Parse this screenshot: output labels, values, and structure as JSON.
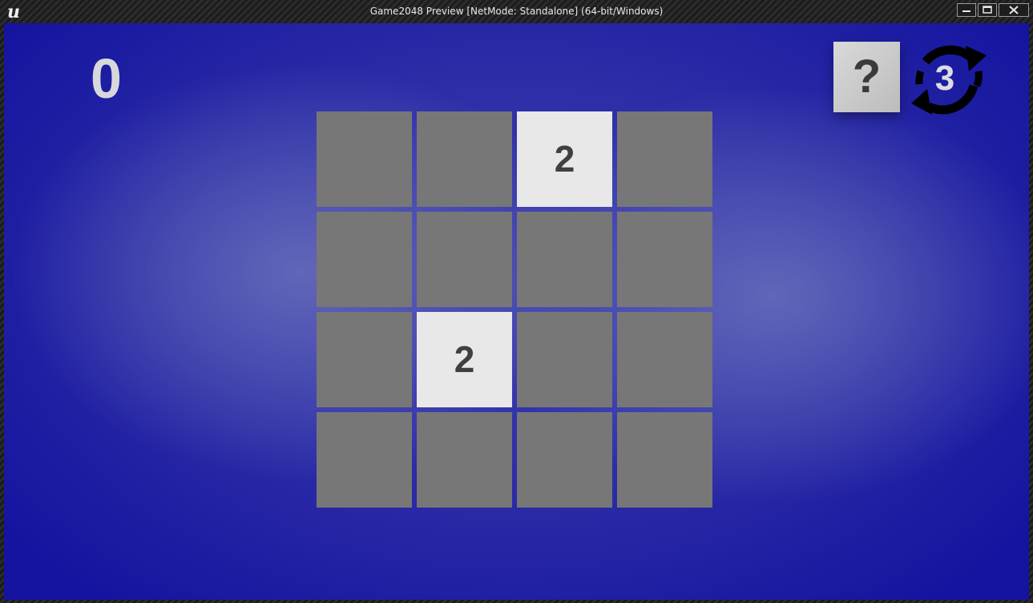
{
  "window": {
    "title": "Game2048 Preview [NetMode: Standalone] (64-bit/Windows)",
    "logo_icon": "unreal-engine-logo-icon",
    "logo_letter": "u",
    "controls": [
      "minimize-icon",
      "maximize-icon",
      "close-icon"
    ]
  },
  "game": {
    "score": "0",
    "help_label": "?",
    "undo_count": "3",
    "undo_icon": "circular-arrows-icon",
    "board": {
      "rows": 4,
      "cols": 4,
      "tiles": [
        [
          "",
          "",
          "2",
          ""
        ],
        [
          "",
          "",
          "",
          ""
        ],
        [
          "",
          "2",
          "",
          ""
        ],
        [
          "",
          "",
          "",
          ""
        ]
      ]
    }
  },
  "colors": {
    "background": "#2a2aa6",
    "empty_tile": "#777777",
    "tile_2": "#e8e8e8",
    "tile_text": "#404040",
    "score_text": "#d8d8dc"
  }
}
